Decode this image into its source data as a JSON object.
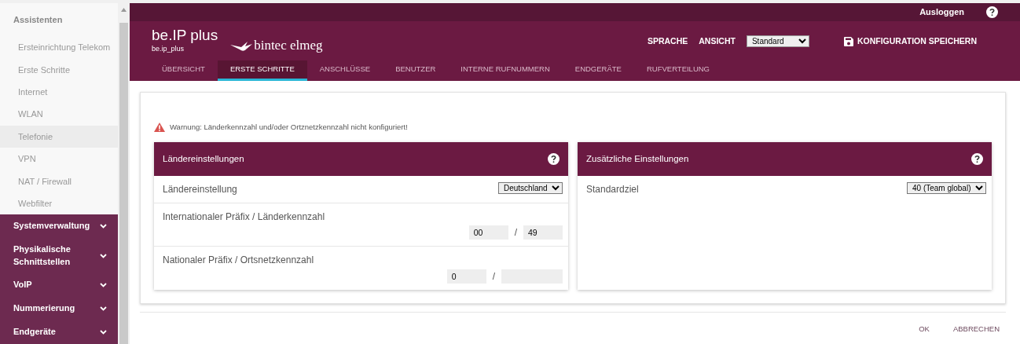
{
  "sidebar": {
    "heading": "Assistenten",
    "items": [
      {
        "label": "Ersteinrichtung Telekom",
        "selected": false
      },
      {
        "label": "Erste Schritte",
        "selected": false
      },
      {
        "label": "Internet",
        "selected": false
      },
      {
        "label": "WLAN",
        "selected": false
      },
      {
        "label": "Telefonie",
        "selected": true
      },
      {
        "label": "VPN",
        "selected": false
      },
      {
        "label": "NAT / Firewall",
        "selected": false
      },
      {
        "label": "Webfilter",
        "selected": false
      }
    ],
    "sections": [
      {
        "label": "Systemverwaltung",
        "expanded": false
      },
      {
        "label": "Physikalische Schnittstellen",
        "expanded": false
      },
      {
        "label": "VoIP",
        "expanded": false
      },
      {
        "label": "Nummerierung",
        "expanded": false
      },
      {
        "label": "Endgeräte",
        "expanded": false
      }
    ]
  },
  "topbar": {
    "logout": "Ausloggen"
  },
  "header": {
    "title": "be.IP plus",
    "subtitle": "be.ip_plus",
    "brand": "bintec elmeg",
    "language": "SPRACHE",
    "view_label": "ANSICHT",
    "view_value": "Standard",
    "save": "KONFIGURATION SPEICHERN"
  },
  "tabs": [
    {
      "label": "ÜBERSICHT",
      "selected": false
    },
    {
      "label": "ERSTE SCHRITTE",
      "selected": true
    },
    {
      "label": "ANSCHLÜSSE",
      "selected": false
    },
    {
      "label": "BENUTZER",
      "selected": false
    },
    {
      "label": "INTERNE RUFNUMMERN",
      "selected": false
    },
    {
      "label": "ENDGERÄTE",
      "selected": false
    },
    {
      "label": "RUFVERTEILUNG",
      "selected": false
    }
  ],
  "warning": "Warnung: Länderkennzahl und/oder Ortznetzkennzahl nicht konfiguriert!",
  "panels": [
    {
      "title": "Ländereinstellungen",
      "rows": [
        {
          "kind": "select",
          "label": "Ländereinstellung",
          "value": "Deutschland"
        },
        {
          "kind": "pair",
          "label": "Internationaler Präfix / Länderkennzahl",
          "separator": "/",
          "fields": [
            {
              "value": "00",
              "empty": false
            },
            {
              "value": "49",
              "empty": false
            }
          ]
        },
        {
          "kind": "pair",
          "label": "Nationaler Präfix / Ortsnetzkennzahl",
          "separator": "/",
          "fields": [
            {
              "value": "0",
              "empty": false
            },
            {
              "empty": true
            }
          ]
        }
      ]
    },
    {
      "title": "Zusätzliche Einstellungen",
      "rows": [
        {
          "kind": "select",
          "label": "Standardziel",
          "value": "40 (Team global)"
        }
      ]
    }
  ],
  "buttons": [
    "OK",
    "ABBRECHEN"
  ]
}
